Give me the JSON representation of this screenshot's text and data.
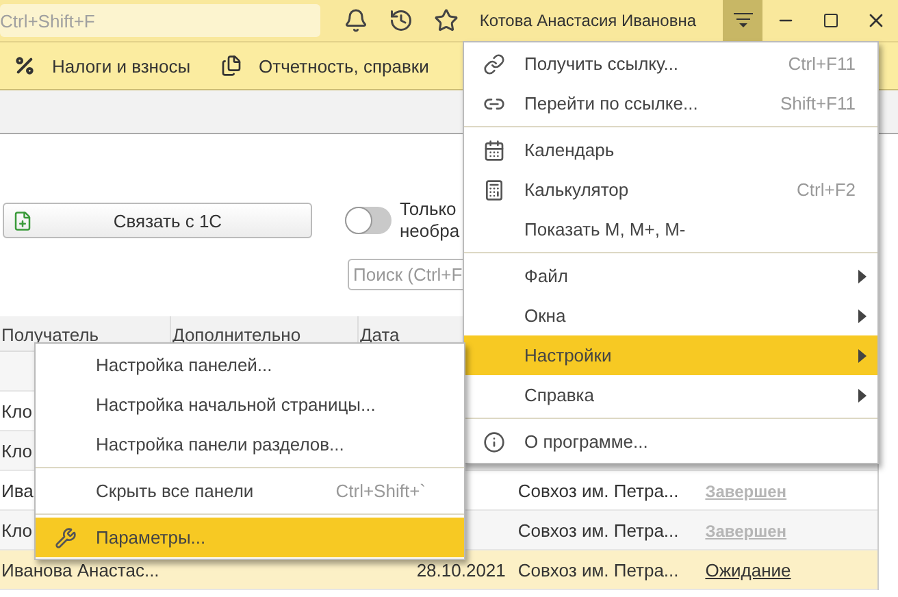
{
  "titlebar": {
    "search": {
      "placeholder": "Ctrl+Shift+F"
    },
    "user": "Котова Анастасия Ивановна",
    "menu_open": true
  },
  "sections": [
    {
      "label": "Налоги и взносы"
    },
    {
      "label": "Отчетность, справки"
    }
  ],
  "toolbar": {
    "button": "Связать с 1С",
    "toggle": {
      "label_lines": [
        "Только",
        "необра"
      ],
      "on": false
    },
    "search": {
      "placeholder": "Поиск (Ctrl+F"
    }
  },
  "table": {
    "columns": [
      "Получатель",
      "Дополнительно",
      "Дата"
    ],
    "rows": [
      {
        "selected": false
      },
      {
        "column_1": "Кло",
        "selected": false
      },
      {
        "column_1": "Кло",
        "selected": false
      },
      {
        "column_1": "Ива",
        "column_4": "Совхоз им. Петра...",
        "column_5": "Завершен",
        "column_5_muted": true,
        "selected": false
      },
      {
        "column_1": "Кло",
        "column_4": "Совхоз им. Петра...",
        "column_5": "Завершен",
        "column_5_muted": true,
        "selected": false
      },
      {
        "column_1": "Иванова Анастас...",
        "date": "28.10.2021",
        "column_4": "Совхоз им. Петра...",
        "column_5": "Ожидание",
        "column_5_muted": false,
        "selected": true
      }
    ]
  },
  "main_menu": {
    "groups": [
      [
        {
          "label": "Получить ссылку...",
          "shortcut": "Ctrl+F11",
          "submenu": false,
          "selected": false
        },
        {
          "label": "Перейти по ссылке...",
          "shortcut": "Shift+F11",
          "submenu": false,
          "selected": false
        }
      ],
      [
        {
          "label": "Календарь",
          "submenu": false,
          "selected": false
        },
        {
          "label": "Калькулятор",
          "shortcut": "Ctrl+F2",
          "submenu": false,
          "selected": false
        },
        {
          "label": "Показать M, M+, M-",
          "submenu": false,
          "selected": false
        }
      ],
      [
        {
          "label": "Файл",
          "submenu": true,
          "selected": false
        },
        {
          "label": "Окна",
          "submenu": true,
          "selected": false
        },
        {
          "label": "Настройки",
          "submenu": true,
          "selected": true
        },
        {
          "label": "Справка",
          "submenu": true,
          "selected": false
        }
      ],
      [
        {
          "label": "О программе...",
          "submenu": false,
          "selected": false
        }
      ]
    ]
  },
  "submenu": {
    "groups": [
      [
        {
          "label": "Настройка панелей...",
          "selected": false
        },
        {
          "label": "Настройка начальной страницы...",
          "selected": false
        },
        {
          "label": "Настройка панели разделов...",
          "selected": false
        }
      ],
      [
        {
          "label": "Скрыть все панели",
          "shortcut": "Ctrl+Shift+`",
          "selected": false
        }
      ],
      [
        {
          "label": "Параметры...",
          "selected": true
        }
      ]
    ]
  }
}
